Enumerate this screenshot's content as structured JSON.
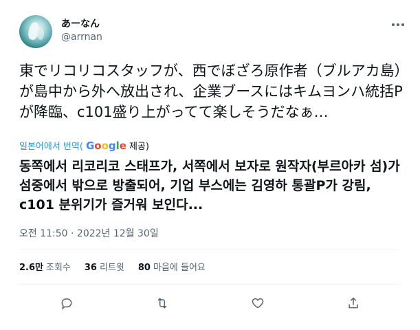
{
  "author": {
    "display_name": "あーなん",
    "handle": "@arrnan"
  },
  "tweet": {
    "original_text": "東でリコリコスタッフが、西でぼざろ原作者（ブルアカ島）が島中から外へ放出され、企業ブースにはキムヨンハ統括Pが降臨、c101盛り上がってて楽しそうだなぁ…",
    "translate_prefix": "일본어에서 번역(",
    "translate_provider_logo": "Google",
    "translate_suffix": " 제공)",
    "translated_text": "동쪽에서 리코리코 스태프가, 서쪽에서 보자로 원작자(부르아카 섬)가 섬중에서 밖으로 방출되어, 기업 부스에는 김영하 통괄P가 강림, c101 분위기가 즐거워 보인다...",
    "timestamp": "오전 11:50 · 2022년 12월 30일"
  },
  "stats": {
    "views_num": "2.6만",
    "views_label": "조회수",
    "retweets_num": "36",
    "retweets_label": "리트윗",
    "likes_num": "80",
    "likes_label": "마음에 들어요"
  },
  "icons": {
    "more": "more-icon",
    "reply": "reply-icon",
    "retweet": "retweet-icon",
    "like": "heart-icon",
    "share": "share-icon"
  },
  "colors": {
    "link": "#1d9bf0",
    "muted": "#536471",
    "text": "#0f1419"
  }
}
